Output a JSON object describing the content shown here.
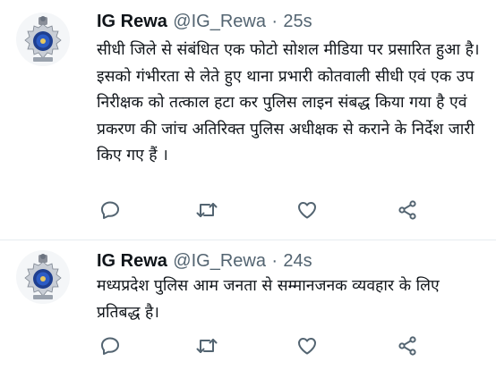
{
  "tweets": [
    {
      "name": "IG Rewa",
      "handle": "@IG_Rewa",
      "separator": "·",
      "time": "25s",
      "text": "सीधी जिले से संबंधित एक फोटो सोशल मीडिया पर प्रसारित हुआ है। इसको गंभीरता से लेते हुए थाना प्रभारी कोतवाली सीधी एवं एक उप निरीक्षक को तत्काल हटा कर पुलिस लाइन संबद्ध किया गया है एवं प्रकरण की जांच अतिरिक्त पुलिस अधीक्षक से कराने के निर्देश जारी किए गए हैं ।"
    },
    {
      "name": "IG Rewa",
      "handle": "@IG_Rewa",
      "separator": "·",
      "time": "24s",
      "text": "मध्यप्रदेश पुलिस आम जनता से सम्मानजनक व्यवहार के लिए प्रतिबद्ध है।"
    }
  ],
  "icons": {
    "reply": "reply-icon",
    "retweet": "retweet-icon",
    "like": "like-icon",
    "share": "share-icon",
    "avatar": "police-emblem-icon"
  },
  "colors": {
    "text": "#0f1419",
    "muted": "#536471",
    "divider": "#e6ecf0",
    "emblem_blue": "#1f3f8f"
  }
}
